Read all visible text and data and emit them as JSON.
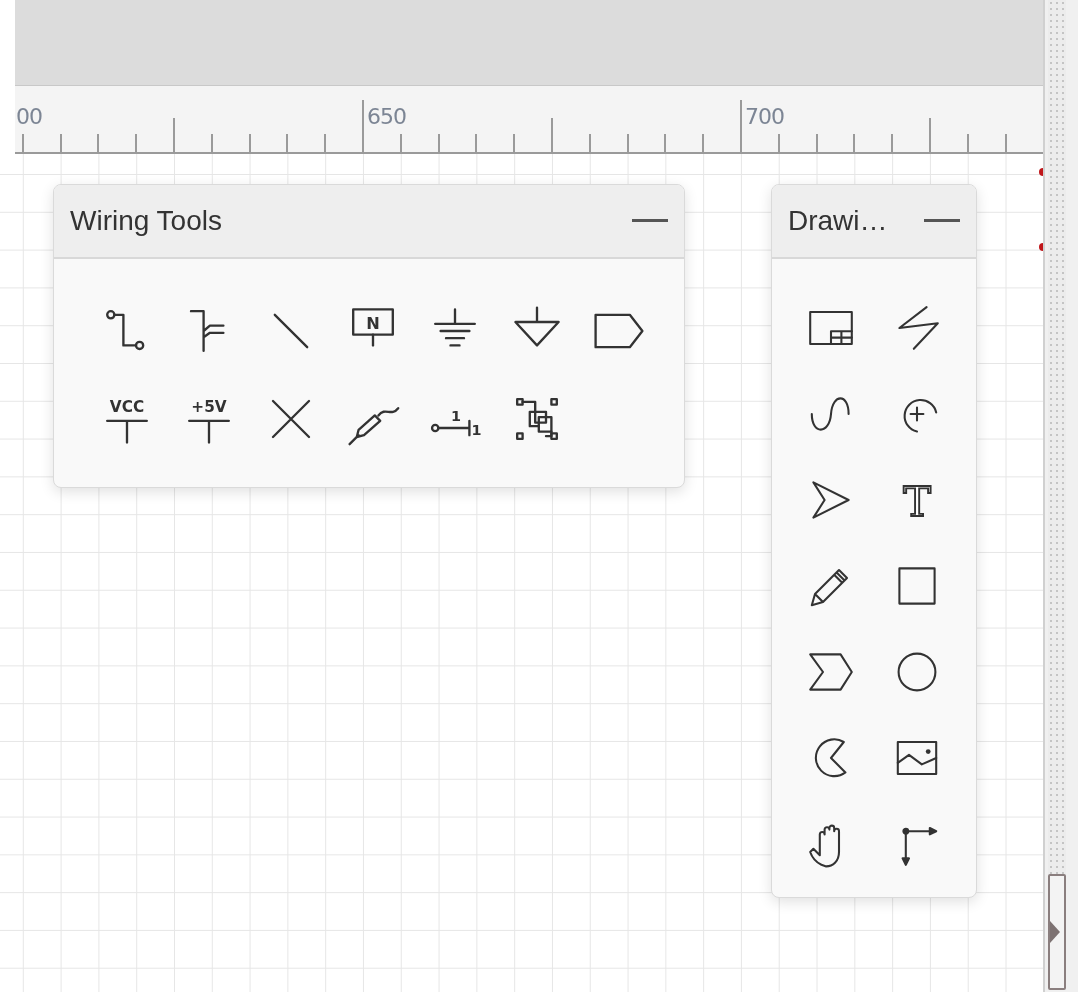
{
  "ruler": {
    "labels": [
      "00",
      "650",
      "700"
    ]
  },
  "panels": [
    {
      "title": "Wiring Tools",
      "tools": [
        {
          "kind": "wire"
        },
        {
          "kind": "bus-entry"
        },
        {
          "kind": "line"
        },
        {
          "kind": "net-label",
          "labels": [
            "N"
          ]
        },
        {
          "kind": "ground"
        },
        {
          "kind": "signal-ground"
        },
        {
          "kind": "port"
        },
        {
          "kind": "power",
          "labels": [
            "VCC"
          ]
        },
        {
          "kind": "power",
          "labels": [
            "+5V"
          ]
        },
        {
          "kind": "no-connect"
        },
        {
          "kind": "probe"
        },
        {
          "kind": "pin",
          "labels": [
            "1",
            "1"
          ]
        },
        {
          "kind": "group"
        }
      ]
    },
    {
      "title": "Drawi…",
      "tools": [
        {
          "kind": "frame"
        },
        {
          "kind": "zigzag"
        },
        {
          "kind": "curve"
        },
        {
          "kind": "arc"
        },
        {
          "kind": "pointer"
        },
        {
          "kind": "text",
          "labels": [
            "T"
          ]
        },
        {
          "kind": "pencil"
        },
        {
          "kind": "rectangle"
        },
        {
          "kind": "chevron"
        },
        {
          "kind": "circle"
        },
        {
          "kind": "pie"
        },
        {
          "kind": "image"
        },
        {
          "kind": "hand"
        },
        {
          "kind": "connector"
        }
      ]
    }
  ]
}
